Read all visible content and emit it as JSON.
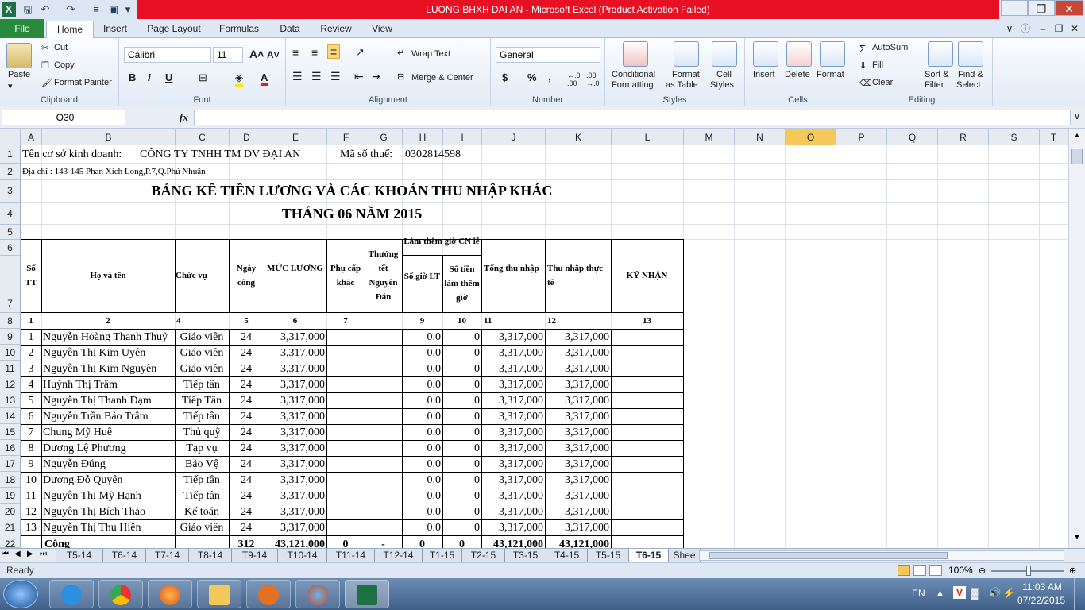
{
  "titlebar": {
    "title": "LUONG BHXH DAI AN  -  Microsoft Excel (Product Activation Failed)",
    "excel_icon": "X"
  },
  "tabs": [
    "File",
    "Home",
    "Insert",
    "Page Layout",
    "Formulas",
    "Data",
    "Review",
    "View"
  ],
  "ribbon": {
    "clipboard": {
      "paste": "Paste",
      "cut": "Cut",
      "copy": "Copy",
      "format_painter": "Format Painter",
      "label": "Clipboard"
    },
    "font": {
      "name": "Calibri",
      "size": "11",
      "label": "Font",
      "bold": "B",
      "italic": "I",
      "underline": "U"
    },
    "alignment": {
      "wrap": "Wrap Text",
      "merge": "Merge & Center",
      "label": "Alignment"
    },
    "number": {
      "format": "General",
      "label": "Number",
      "currency": "$",
      "percent": "%",
      "comma": ","
    },
    "styles": {
      "conditional": "Conditional",
      "conditional2": "Formatting",
      "format_table": "Format",
      "format_table2": "as Table",
      "cell_styles": "Cell",
      "cell_styles2": "Styles",
      "label": "Styles"
    },
    "cells": {
      "insert": "Insert",
      "delete": "Delete",
      "format": "Format",
      "label": "Cells"
    },
    "editing": {
      "autosum": "AutoSum",
      "fill": "Fill",
      "clear": "Clear",
      "sort": "Sort &",
      "sort2": "Filter",
      "find": "Find &",
      "find2": "Select",
      "label": "Editing"
    }
  },
  "namebox": "O30",
  "fx": "fx",
  "columns": [
    "A",
    "B",
    "C",
    "D",
    "E",
    "F",
    "G",
    "H",
    "I",
    "J",
    "K",
    "L",
    "M",
    "N",
    "O",
    "P",
    "Q",
    "R",
    "S",
    "T"
  ],
  "rows": [
    "1",
    "2",
    "3",
    "4",
    "5",
    "6",
    "7",
    "8",
    "9",
    "10",
    "11",
    "12",
    "13",
    "14",
    "15",
    "16",
    "17",
    "18",
    "19",
    "20",
    "21",
    "22"
  ],
  "sheet": {
    "company_label": "Tên cơ sở kinh doanh:",
    "company": "CÔNG TY TNHH TM DV ĐẠI AN",
    "tax_label": "Mã số thuế:",
    "tax": "0302814598",
    "address": "Địa chỉ :  143-145 Phan Xích Long,P.7,Q.Phú Nhuận",
    "title1": "BẢNG KÊ TIỀN LƯƠNG VÀ CÁC KHOẢN THU NHẬP KHÁC",
    "title2": "THÁNG 06 NĂM 2015",
    "headers": {
      "stt": "Số TT",
      "name": "Họ và tên",
      "position": "Chức vụ",
      "days": "Ngày công",
      "salary": "MỨC LƯƠNG",
      "allowance": "Phụ cấp khác",
      "tet": "Thưởng tết Nguyên Đán",
      "overtime": "Làm thêm giờ CN lễ",
      "ot_hours": "Số giờ LT",
      "ot_amount": "Số tiền làm thêm giờ",
      "total": "Tổng thu nhập",
      "net": "Thu nhập thực tế",
      "sign": "KÝ NHẬN"
    },
    "colnums": [
      "1",
      "2",
      "4",
      "5",
      "6",
      "7",
      "",
      "9",
      "10",
      "11",
      "12",
      "13"
    ],
    "employees": [
      {
        "stt": "1",
        "name": "Nguyễn Hoàng Thanh Thuỷ",
        "pos": "Giáo viên",
        "days": "24",
        "salary": "3,317,000",
        "hours": "0.0",
        "ot": "0",
        "total": "3,317,000",
        "net": "3,317,000"
      },
      {
        "stt": "2",
        "name": "Nguyễn Thị Kim Uyên",
        "pos": "Giáo viên",
        "days": "24",
        "salary": "3,317,000",
        "hours": "0.0",
        "ot": "0",
        "total": "3,317,000",
        "net": "3,317,000"
      },
      {
        "stt": "3",
        "name": "Nguyễn Thị Kim Nguyên",
        "pos": "Giáo viên",
        "days": "24",
        "salary": "3,317,000",
        "hours": "0.0",
        "ot": "0",
        "total": "3,317,000",
        "net": "3,317,000"
      },
      {
        "stt": "4",
        "name": "Huỳnh Thị Trâm",
        "pos": "Tiếp tân",
        "days": "24",
        "salary": "3,317,000",
        "hours": "0.0",
        "ot": "0",
        "total": "3,317,000",
        "net": "3,317,000"
      },
      {
        "stt": "5",
        "name": "Nguyễn Thị Thanh Đạm",
        "pos": "Tiếp Tân",
        "days": "24",
        "salary": "3,317,000",
        "hours": "0.0",
        "ot": "0",
        "total": "3,317,000",
        "net": "3,317,000"
      },
      {
        "stt": "6",
        "name": "Nguyễn Trần Bảo Trâm",
        "pos": "Tiếp tân",
        "days": "24",
        "salary": "3,317,000",
        "hours": "0.0",
        "ot": "0",
        "total": "3,317,000",
        "net": "3,317,000"
      },
      {
        "stt": "7",
        "name": "Chung Mỹ Huê",
        "pos": "Thủ quỹ",
        "days": "24",
        "salary": "3,317,000",
        "hours": "0.0",
        "ot": "0",
        "total": "3,317,000",
        "net": "3,317,000"
      },
      {
        "stt": "8",
        "name": "Dương Lệ Phương",
        "pos": "Tạp vụ",
        "days": "24",
        "salary": "3,317,000",
        "hours": "0.0",
        "ot": "0",
        "total": "3,317,000",
        "net": "3,317,000"
      },
      {
        "stt": "9",
        "name": "Nguyễn Đúng",
        "pos": "Bảo Vệ",
        "days": "24",
        "salary": "3,317,000",
        "hours": "0.0",
        "ot": "0",
        "total": "3,317,000",
        "net": "3,317,000"
      },
      {
        "stt": "10",
        "name": "Dương Đỗ Quyên",
        "pos": "Tiếp tân",
        "days": "24",
        "salary": "3,317,000",
        "hours": "0.0",
        "ot": "0",
        "total": "3,317,000",
        "net": "3,317,000"
      },
      {
        "stt": "11",
        "name": "Nguyễn Thị Mỹ Hạnh",
        "pos": "Tiếp tân",
        "days": "24",
        "salary": "3,317,000",
        "hours": "0.0",
        "ot": "0",
        "total": "3,317,000",
        "net": "3,317,000"
      },
      {
        "stt": "12",
        "name": "Nguyễn Thị Bích Thảo",
        "pos": "Kế toán",
        "days": "24",
        "salary": "3,317,000",
        "hours": "0.0",
        "ot": "0",
        "total": "3,317,000",
        "net": "3,317,000"
      },
      {
        "stt": "13",
        "name": "Nguyễn Thị Thu Hiền",
        "pos": "Giáo viên",
        "days": "24",
        "salary": "3,317,000",
        "hours": "0.0",
        "ot": "0",
        "total": "3,317,000",
        "net": "3,317,000"
      }
    ],
    "total_row": {
      "label": "Cộng",
      "days": "312",
      "salary": "43,121,000",
      "allowance": "0",
      "tet": "-",
      "hours": "0",
      "ot": "0",
      "total": "43,121,000",
      "net": "43,121,000"
    }
  },
  "sheet_tabs": [
    "T5-14",
    "T6-14",
    "T7-14",
    "T8-14",
    "T9-14",
    "T10-14",
    "T11-14",
    "T12-14",
    "T1-15",
    "T2-15",
    "T3-15",
    "T4-15",
    "T5-15",
    "T6-15",
    "Shee"
  ],
  "active_sheet": "T6-15",
  "status": {
    "ready": "Ready",
    "zoom": "100%"
  },
  "taskbar": {
    "lang": "EN",
    "time": "11:03 AM",
    "date": "07/22/2015"
  },
  "colors": {
    "title_red": "#e81123",
    "file_green": "#2a8a3c",
    "selected_col": "#f5c85a"
  }
}
